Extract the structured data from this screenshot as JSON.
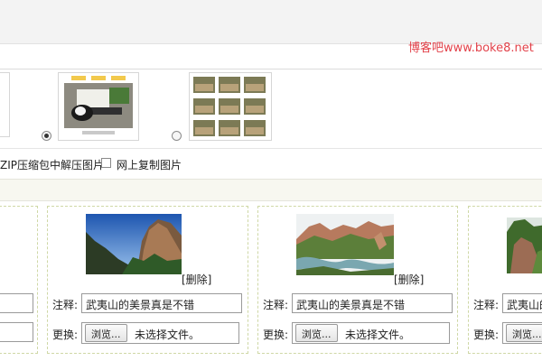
{
  "watermark": "博客吧www.boke8.net",
  "import_options": {
    "zip_label": "ZIP压缩包中解压图片",
    "web_copy_label": "网上复制图片"
  },
  "photos": [
    {
      "caption_label": "注释:",
      "caption_value": "武夷山的美景真是不错",
      "delete_label": "[删除]",
      "replace_label": "更换:",
      "browse_label": "浏览...",
      "file_status": "未选择文件。"
    },
    {
      "caption_label": "注释:",
      "caption_value": "武夷山的美景真是不错",
      "delete_label": "[删除]",
      "replace_label": "更换:",
      "browse_label": "浏览...",
      "file_status": "未选择文件。"
    },
    {
      "caption_label": "注释:",
      "caption_value": "武夷山的",
      "replace_label": "更换:",
      "browse_label": "浏览..."
    }
  ],
  "colors": {
    "watermark": "#e2424a",
    "card_border": "#cfd8a6",
    "band_bg": "#f7f7f0"
  }
}
